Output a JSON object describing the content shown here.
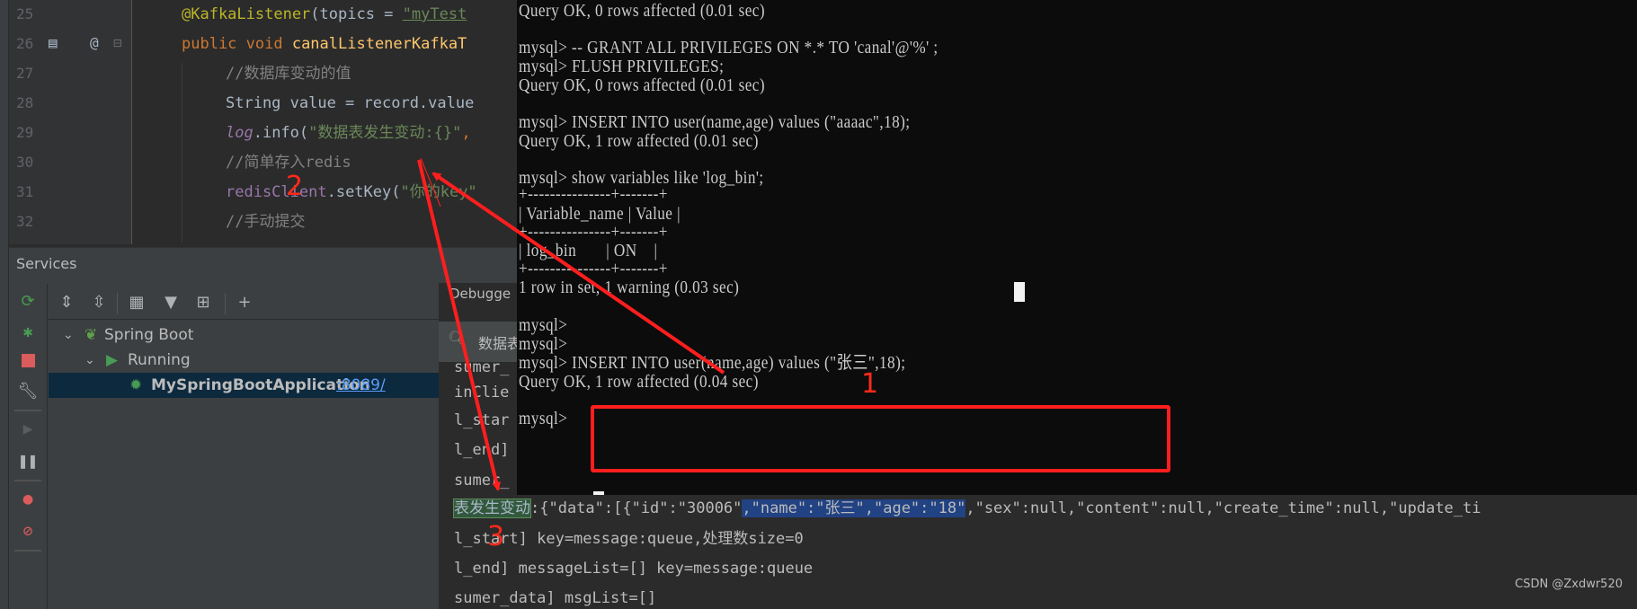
{
  "editor": {
    "lines": [
      {
        "num": "25",
        "tokens": [
          [
            "t-anno",
            "@KafkaListener"
          ],
          [
            "t-plain",
            "(topics = "
          ],
          [
            "t-str-u",
            "\"myTest"
          ]
        ]
      },
      {
        "num": "26",
        "tokens": [
          [
            "t-kw",
            "public void "
          ],
          [
            "t-fn",
            "canalListenerKafkaT"
          ]
        ]
      },
      {
        "num": "27",
        "tokens": [
          [
            "t-com",
            "//数据库变动的值"
          ]
        ]
      },
      {
        "num": "28",
        "tokens": [
          [
            "t-plain",
            "String value = record.value"
          ]
        ]
      },
      {
        "num": "29",
        "tokens": [
          [
            "t-field",
            "log"
          ],
          [
            "t-plain",
            ".info("
          ],
          [
            "t-str",
            "\"数据表发生变动:{}\""
          ],
          [
            "t-kw",
            ","
          ]
        ]
      },
      {
        "num": "30",
        "tokens": [
          [
            "t-com",
            "//简单存入redis"
          ]
        ]
      },
      {
        "num": "31",
        "tokens": [
          [
            "t-field2",
            "redisClient"
          ],
          [
            "t-plain",
            ".setKey("
          ],
          [
            "t-str",
            "\"你的key\""
          ]
        ]
      },
      {
        "num": "32",
        "tokens": [
          [
            "t-com",
            "//手动提交"
          ]
        ]
      }
    ]
  },
  "services": {
    "title": "Services",
    "tree": {
      "root": "Spring Boot",
      "group": "Running",
      "app_name": "MySpringBootApplication",
      "app_port_link": ":8089/"
    }
  },
  "console": {
    "tab_label": "Debugge",
    "search_text": "数据表",
    "lines_hidden": [
      "sumer_",
      "inClie",
      "l_star",
      "l_end]",
      "sumer_"
    ],
    "log_line": {
      "highlight_green": "表发生变动",
      "part1": ":{\"data\":[{\"id\":\"30006\"",
      "highlight_blue": ",\"name\":\"张三\",\"age\":\"18\"",
      "part2": ",\"sex\":null,\"content\":null,\"create_time\":null,\"update_ti"
    },
    "lines_after": [
      "l_start] key=message:queue,处理数size=0",
      "l_end] messageList=[] key=message:queue",
      "sumer_data] msgList=[]"
    ]
  },
  "terminal": {
    "lines": [
      "Query OK, 0 rows affected (0.01 sec)",
      "",
      "mysql> -- GRANT ALL PRIVILEGES ON *.* TO 'canal'@'%' ;",
      "mysql> FLUSH PRIVILEGES;",
      "Query OK, 0 rows affected (0.01 sec)",
      "",
      "mysql> INSERT INTO user(name,age) values (\"aaaac\",18);",
      "Query OK, 1 row affected (0.01 sec)",
      "",
      "mysql> show variables like 'log_bin';",
      "+---------------+-------+",
      "| Variable_name | Value |",
      "+---------------+-------+",
      "| log_bin       | ON    |",
      "+---------------+-------+",
      "1 row in set, 1 warning (0.03 sec)",
      "",
      "mysql>",
      "mysql>",
      "mysql> INSERT INTO user(name,age) values (\"张三\",18);",
      "Query OK, 1 row affected (0.04 sec)",
      "",
      "mysql> "
    ]
  },
  "annotations": {
    "step1": "1",
    "step2": "2",
    "step3": "3",
    "color": "#ff1e1e"
  },
  "watermark": "CSDN @Zxdwr520"
}
